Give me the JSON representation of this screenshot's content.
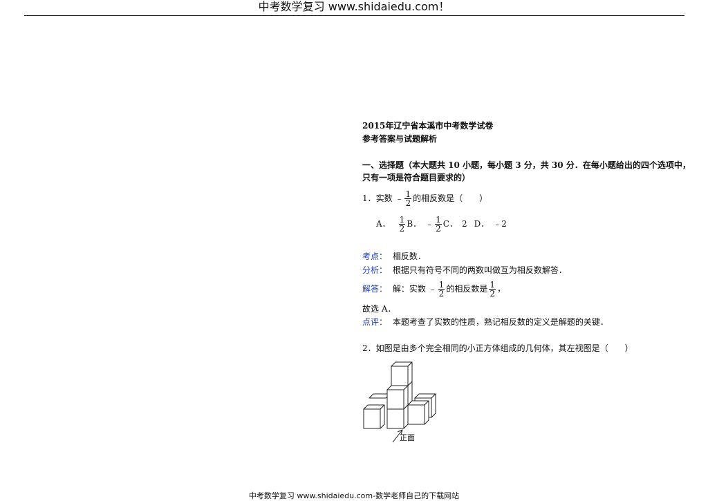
{
  "header": {
    "title": "中考数学复习 www.shidaiedu.com！"
  },
  "doc": {
    "title": "2015年辽宁省本溪市中考数学试卷",
    "subtitle": "参考答案与试题解析",
    "section_heading_line1": "一、选择题（本大题共 10 小题，每小题 3 分，共 30 分．在每小题给出的四个选项中，",
    "section_heading_line2": "只有一项是符合题目要求的）"
  },
  "q1": {
    "prefix": "1．实数 ﹣",
    "frac_num": "1",
    "frac_den": "2",
    "suffix": "的相反数是（　　）",
    "options": {
      "a_label": "A．",
      "a_num": "1",
      "a_den": "2",
      "b_label": "B．　﹣",
      "b_num": "1",
      "b_den": "2",
      "c_label": "C．　2",
      "d_label": "D．　﹣2"
    },
    "kaodian_label": "考点：",
    "kaodian_text": "相反数．",
    "fenxi_label": "分析：",
    "fenxi_text": "根据只有符号不同的两数叫做互为相反数解答．",
    "jieda_label": "解答：",
    "jieda_prefix": "解：实数 ﹣",
    "jieda_num1": "1",
    "jieda_den1": "2",
    "jieda_mid": "的相反数是",
    "jieda_num2": "1",
    "jieda_den2": "2",
    "jieda_end": "，",
    "guxuan": "故选 A．",
    "dianping_label": "点评：",
    "dianping_text": "本题考查了实数的性质，熟记相反数的定义是解题的关键．"
  },
  "q2": {
    "text": "2．如图是由多个完全相同的小正方体组成的几何体，其左视图是（　　）",
    "figure_label": "正面"
  },
  "footer": {
    "text": "中考数学复习 www.shidaiedu.com-数学老师自己的下载网站"
  }
}
